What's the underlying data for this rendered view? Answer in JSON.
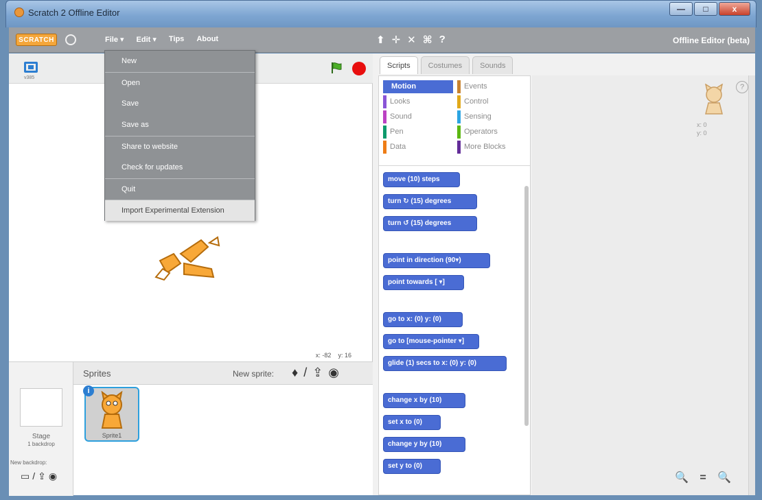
{
  "window": {
    "title": "Scratch 2 Offline Editor",
    "controls": [
      "—",
      "□",
      "x"
    ]
  },
  "menubar": {
    "logo": "SCRATCH",
    "items": [
      "File ▾",
      "Edit ▾",
      "Tips",
      "About"
    ],
    "edition": "Offline Editor (beta)",
    "toolbar_icons": [
      "duplicate-icon",
      "cut-icon",
      "grow-icon",
      "shrink-icon",
      "help-icon"
    ],
    "toolbar_glyphs": [
      "⬆",
      "✛",
      "✕",
      "⌘",
      "?"
    ]
  },
  "stage": {
    "version_label": "v385",
    "mouse_x_label": "x:",
    "mouse_x": "-82",
    "mouse_y_label": "y:",
    "mouse_y": "16"
  },
  "file_menu": {
    "items": [
      "New",
      "Open",
      "Save",
      "Save as",
      "Share to website",
      "Check for updates",
      "Quit",
      "Import Experimental Extension"
    ]
  },
  "sprites": {
    "title": "Sprites",
    "new_sprite_label": "New sprite:",
    "sprite_name": "Sprite1",
    "info_badge": "i"
  },
  "stage_panel": {
    "label": "Stage",
    "backdrop_count": "1 backdrop",
    "new_backdrop_label": "New backdrop:"
  },
  "tabs": [
    "Scripts",
    "Costumes",
    "Sounds"
  ],
  "categories": [
    {
      "name": "Motion",
      "color": "#4a6cd4",
      "active": true
    },
    {
      "name": "Events",
      "color": "#c88330"
    },
    {
      "name": "Looks",
      "color": "#8a55d7"
    },
    {
      "name": "Control",
      "color": "#e1a91a"
    },
    {
      "name": "Sound",
      "color": "#bb42c3"
    },
    {
      "name": "Sensing",
      "color": "#2ca5e2"
    },
    {
      "name": "Pen",
      "color": "#0e9a6c"
    },
    {
      "name": "Operators",
      "color": "#5cb712"
    },
    {
      "name": "Data",
      "color": "#ee7d16"
    },
    {
      "name": "More Blocks",
      "color": "#632d99"
    }
  ],
  "blocks": [
    "move (10) steps",
    "turn ↻ (15) degrees",
    "turn ↺ (15) degrees",
    "point in direction (90▾)",
    "point towards [ ▾]",
    "go to x: (0) y: (0)",
    "go to [mouse-pointer ▾]",
    "glide (1) secs to x: (0) y: (0)",
    "change x by (10)",
    "set x to (0)",
    "change y by (10)",
    "set y to (0)"
  ],
  "script_area": {
    "sprite_x": "x: 0",
    "sprite_y": "y: 0",
    "zoom": "🔍 = 🔍",
    "help": "?"
  }
}
